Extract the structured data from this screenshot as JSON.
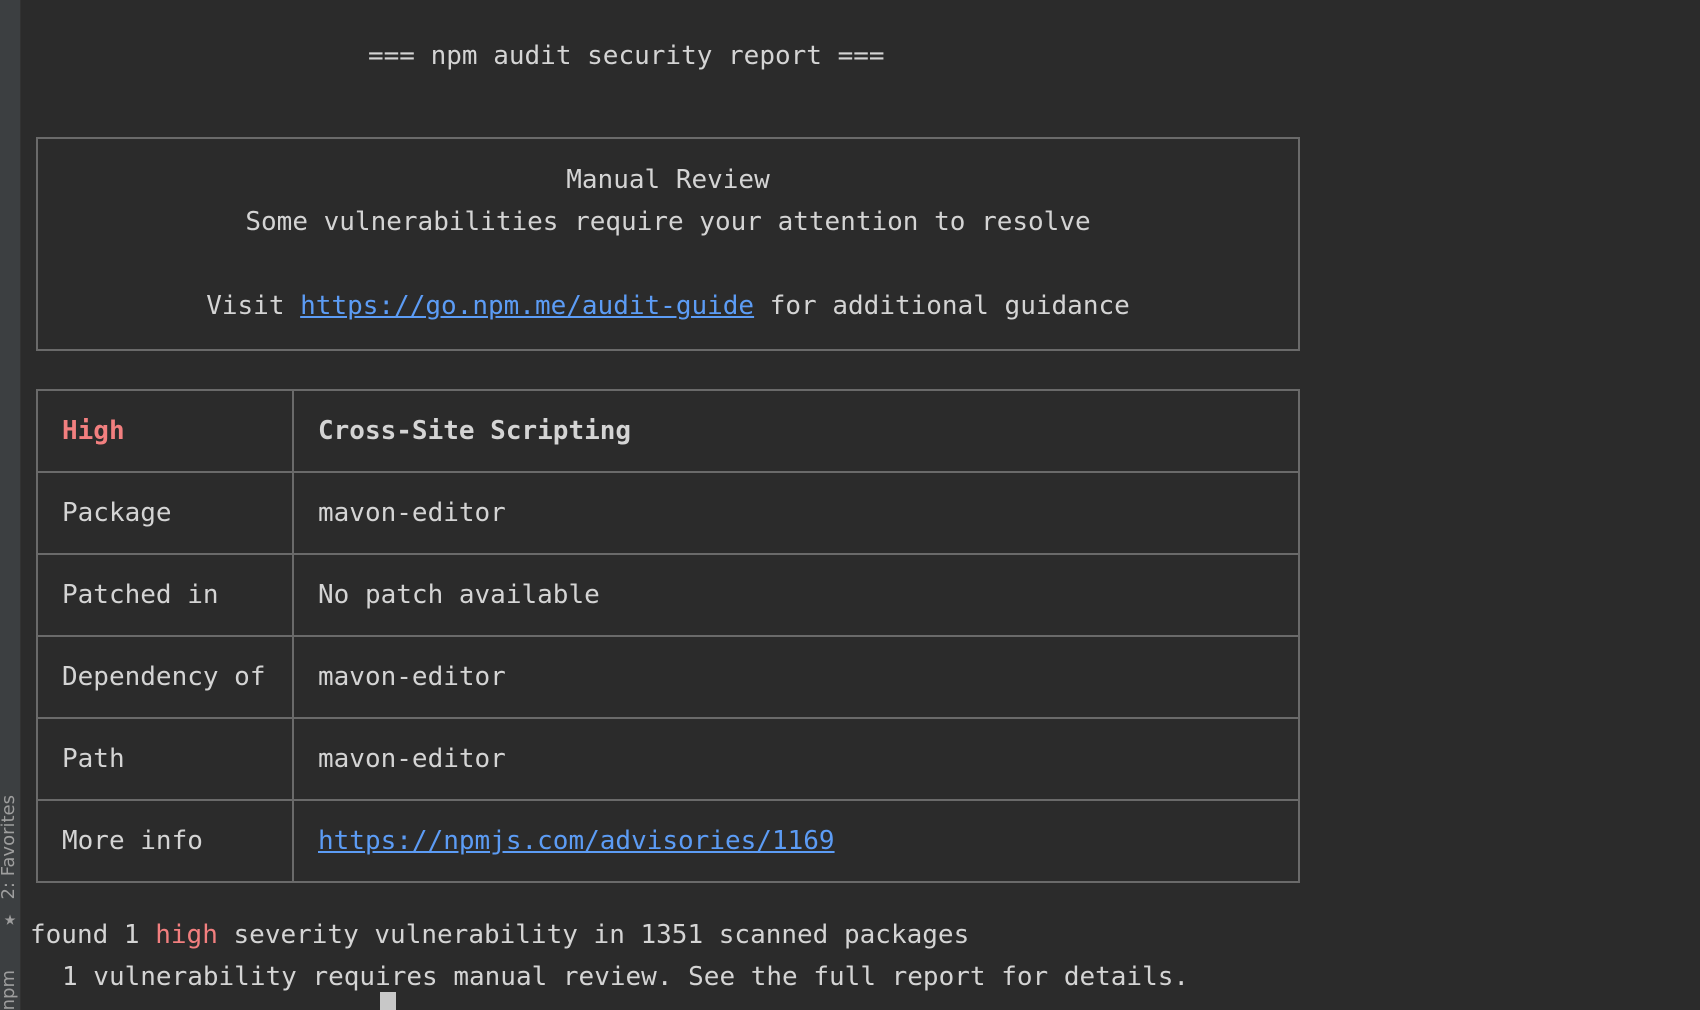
{
  "sidebar": {
    "favorites_label": "2: Favorites",
    "npm_label": "npm"
  },
  "report": {
    "title": "=== npm audit security report ==="
  },
  "manual_review": {
    "heading": "Manual Review",
    "subheading": "Some vulnerabilities require your attention to resolve",
    "visit_prefix": "Visit ",
    "guide_link": "https://go.npm.me/audit-guide",
    "visit_suffix": " for additional guidance"
  },
  "advisory": {
    "severity": "High",
    "name": "Cross-Site Scripting",
    "rows": [
      {
        "label": "Package",
        "value": "mavon-editor"
      },
      {
        "label": "Patched in",
        "value": "No patch available"
      },
      {
        "label": "Dependency of",
        "value": "mavon-editor"
      },
      {
        "label": "Path",
        "value": "mavon-editor"
      },
      {
        "label": "More info",
        "value": "https://npmjs.com/advisories/1169"
      }
    ]
  },
  "summary": {
    "line1_prefix": "found 1 ",
    "line1_severity": "high",
    "line1_suffix": " severity vulnerability in 1351 scanned packages",
    "line2": "1 vulnerability requires manual review. See the full report for details."
  },
  "colors": {
    "background": "#2b2b2b",
    "text": "#d4d4d4",
    "high": "#f27f7f",
    "link": "#5c9cf5",
    "border": "#6a6a6a"
  }
}
